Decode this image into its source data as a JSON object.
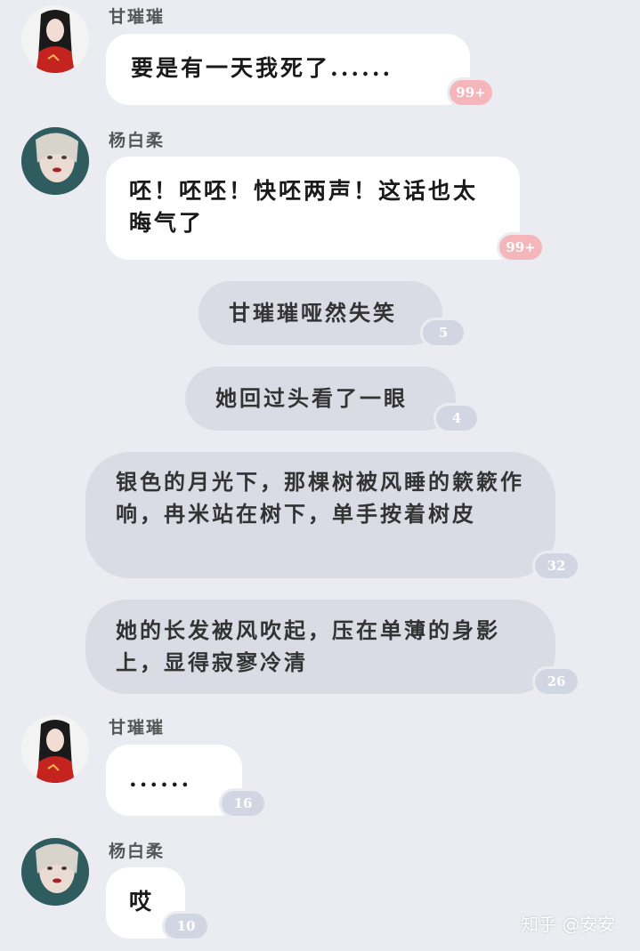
{
  "messages": [
    {
      "sender": "甘璀璀",
      "text": "要是有一天我死了......",
      "badge": "99+"
    },
    {
      "sender": "杨白柔",
      "text": "呸！呸呸！快呸两声！这话也太晦气了",
      "badge": "99+"
    },
    {
      "text": "甘璀璀哑然失笑",
      "badge": "5"
    },
    {
      "text": "她回过头看了一眼",
      "badge": "4"
    },
    {
      "text": "银色的月光下，那棵树被风睡的簌簌作响，冉米站在树下，单手按着树皮",
      "badge": "32"
    },
    {
      "text": "她的长发被风吹起，压在单薄的身影上，显得寂寥冷清",
      "badge": "26"
    },
    {
      "sender": "甘璀璀",
      "text": "......",
      "badge": "16"
    },
    {
      "sender": "杨白柔",
      "text": "哎",
      "badge": "10"
    }
  ],
  "watermark": "知乎 @安安",
  "colors": {
    "background": "#ebecf1",
    "bubble": "#ffffff",
    "narration": "#d9dbe5",
    "badge_hot": "#f4b6bb",
    "badge_cold": "#d2d6e2"
  },
  "icons": [
    "avatar-gan",
    "avatar-yang"
  ]
}
